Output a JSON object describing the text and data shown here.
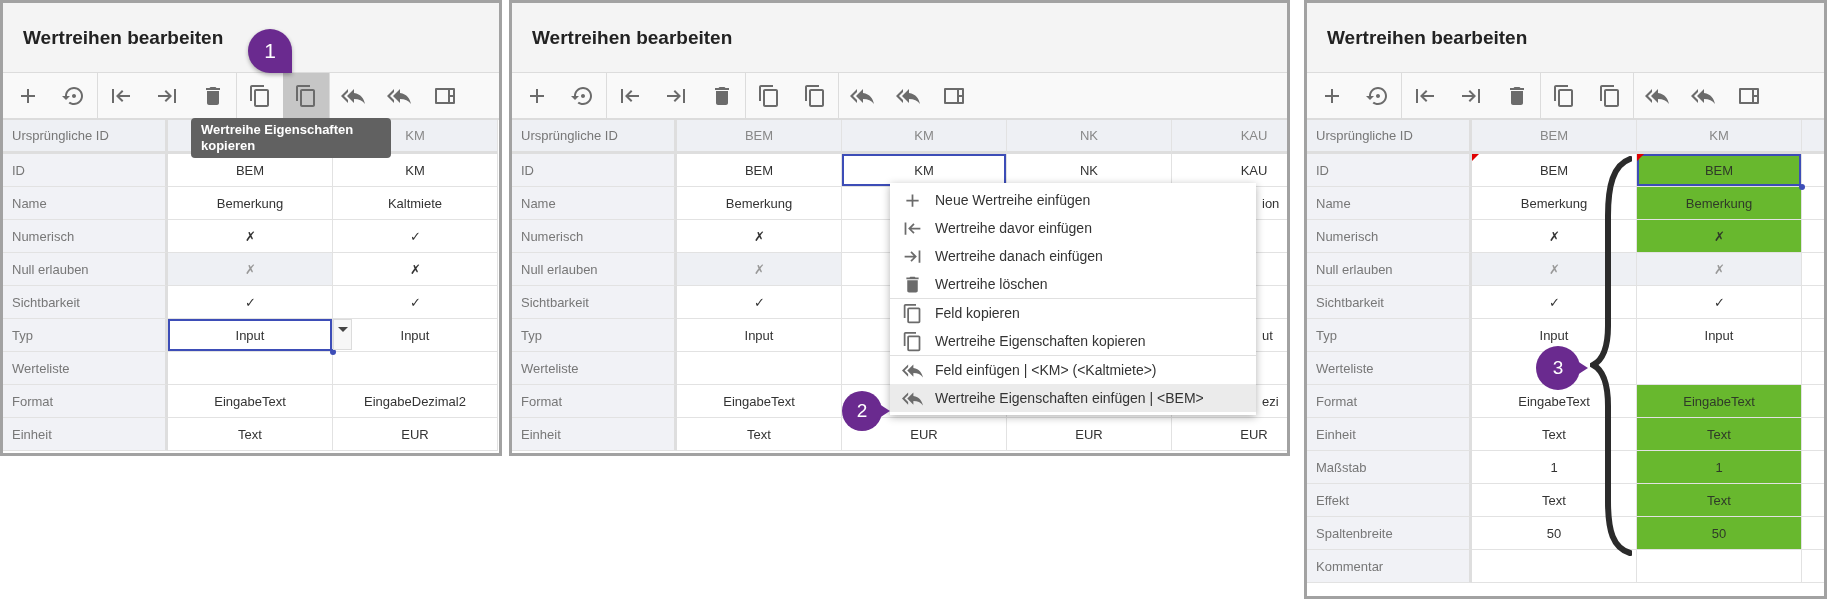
{
  "panels": [
    {
      "title": "Wertreihen bearbeiten",
      "toolbar": [
        [
          {
            "kind": "add",
            "selected": false
          },
          {
            "kind": "restore",
            "selected": false
          }
        ],
        [
          {
            "kind": "before",
            "selected": false
          },
          {
            "kind": "after",
            "selected": false
          },
          {
            "kind": "delete",
            "selected": false
          }
        ],
        [
          {
            "kind": "copy",
            "selected": false
          },
          {
            "kind": "copy",
            "selected": true
          }
        ],
        [
          {
            "kind": "paste",
            "selected": false
          },
          {
            "kind": "paste",
            "selected": false
          },
          {
            "kind": "panel",
            "selected": false
          }
        ]
      ],
      "grid": {
        "corner": "Ursprüngliche ID",
        "columns": [
          {},
          {
            "label": "KM"
          }
        ],
        "rows": [
          {
            "label": "ID",
            "cells": [
              {
                "text": "BEM",
                "selected": false,
                "readonly": false
              },
              {
                "text": "KM",
                "selected": false,
                "readonly": false
              }
            ]
          },
          {
            "label": "Name",
            "cells": [
              {
                "text": "Bemerkung",
                "selected": false,
                "readonly": false
              },
              {
                "text": "Kaltmiete",
                "selected": false,
                "readonly": false
              }
            ]
          },
          {
            "label": "Numerisch",
            "cells": [
              {
                "text": "✗",
                "selected": false,
                "readonly": false
              },
              {
                "text": "✓",
                "selected": false,
                "readonly": false
              }
            ]
          },
          {
            "label": "Null erlauben",
            "cells": [
              {
                "text": "✗",
                "selected": false,
                "readonly": true
              },
              {
                "text": "✗",
                "selected": false,
                "readonly": false
              }
            ]
          },
          {
            "label": "Sichtbarkeit",
            "cells": [
              {
                "text": "✓",
                "selected": false,
                "readonly": false
              },
              {
                "text": "✓",
                "selected": false,
                "readonly": false
              }
            ]
          },
          {
            "label": "Typ",
            "cells": [
              {
                "text": "Input",
                "selected": true,
                "readonly": false,
                "dropdown": true,
                "fill_handle": true
              },
              {
                "text": "Input",
                "selected": false,
                "readonly": false
              }
            ]
          },
          {
            "label": "Werteliste",
            "cells": [
              {
                "selected": false,
                "readonly": false
              },
              {
                "selected": false,
                "readonly": false
              }
            ]
          },
          {
            "label": "Format",
            "cells": [
              {
                "text": "EingabeText",
                "selected": false,
                "readonly": false
              },
              {
                "text": "EingabeDezimal2",
                "selected": false,
                "readonly": false
              }
            ]
          },
          {
            "label": "Einheit",
            "cells": [
              {
                "text": "Text",
                "selected": false,
                "readonly": false
              },
              {
                "text": "EUR",
                "selected": false,
                "readonly": false
              }
            ]
          }
        ]
      },
      "tooltip": "Wertreihe Eigenschaften kopieren",
      "callout": "1"
    },
    {
      "title": "Wertreihen bearbeiten",
      "toolbar": [
        [
          {
            "kind": "add",
            "selected": false
          },
          {
            "kind": "restore",
            "selected": false
          }
        ],
        [
          {
            "kind": "before",
            "selected": false
          },
          {
            "kind": "after",
            "selected": false
          },
          {
            "kind": "delete",
            "selected": false
          }
        ],
        [
          {
            "kind": "copy",
            "selected": false
          },
          {
            "kind": "copy",
            "selected": false
          }
        ],
        [
          {
            "kind": "paste",
            "selected": false
          },
          {
            "kind": "paste",
            "selected": false
          },
          {
            "kind": "panel",
            "selected": false
          }
        ]
      ],
      "grid": {
        "corner": "Ursprüngliche ID",
        "columns": [
          {
            "label": "BEM"
          },
          {
            "label": "KM"
          },
          {
            "label": "NK"
          },
          {
            "label": "KAU"
          }
        ],
        "rows": [
          {
            "label": "ID",
            "cells": [
              {
                "text": "BEM",
                "selected": false,
                "readonly": false
              },
              {
                "text": "KM",
                "selected": true,
                "readonly": false
              },
              {
                "text": "NK",
                "selected": false,
                "readonly": false
              },
              {
                "text": "KAU",
                "selected": false,
                "readonly": false
              }
            ]
          },
          {
            "label": "Name",
            "cells": [
              {
                "text": "Bemerkung",
                "selected": false,
                "readonly": false
              },
              {},
              {},
              {
                "text": "ion",
                "clipped": true,
                "selected": false,
                "readonly": false
              }
            ]
          },
          {
            "label": "Numerisch",
            "cells": [
              {
                "text": "✗",
                "selected": false,
                "readonly": false
              },
              {},
              {},
              {
                "selected": false,
                "readonly": false
              }
            ]
          },
          {
            "label": "Null erlauben",
            "cells": [
              {
                "text": "✗",
                "selected": false,
                "readonly": true
              },
              {},
              {},
              {
                "selected": false,
                "readonly": false
              }
            ]
          },
          {
            "label": "Sichtbarkeit",
            "cells": [
              {
                "text": "✓",
                "selected": false,
                "readonly": false
              },
              {},
              {},
              {
                "selected": false,
                "readonly": false
              }
            ]
          },
          {
            "label": "Typ",
            "cells": [
              {
                "text": "Input",
                "selected": false,
                "readonly": false
              },
              {},
              {},
              {
                "text": "ut",
                "clipped": true,
                "selected": false,
                "readonly": false
              }
            ]
          },
          {
            "label": "Werteliste",
            "cells": [
              {
                "selected": false,
                "readonly": false
              },
              {},
              {},
              {
                "selected": false,
                "readonly": false
              }
            ]
          },
          {
            "label": "Format",
            "cells": [
              {
                "text": "EingabeText",
                "selected": false,
                "readonly": false
              },
              {},
              {},
              {
                "text": "ezi",
                "clipped": true,
                "selected": false,
                "readonly": false
              }
            ]
          },
          {
            "label": "Einheit",
            "cells": [
              {
                "text": "Text",
                "selected": false,
                "readonly": false
              },
              {
                "text": "EUR",
                "selected": false,
                "readonly": false
              },
              {
                "text": "EUR",
                "selected": false,
                "readonly": false
              },
              {
                "text": "EUR",
                "selected": false,
                "readonly": false
              }
            ]
          }
        ]
      },
      "context_menu": [
        [
          {
            "kind": "add",
            "text": "Neue Wertreihe einfügen",
            "selected": false
          },
          {
            "kind": "before",
            "text": "Wertreihe davor einfügen",
            "selected": false
          },
          {
            "kind": "after",
            "text": "Wertreihe danach einfügen",
            "selected": false
          },
          {
            "kind": "delete",
            "text": "Wertreihe löschen",
            "selected": false
          }
        ],
        [
          {
            "kind": "copy",
            "text": "Feld kopieren",
            "selected": false
          },
          {
            "kind": "copy",
            "text": "Wertreihe Eigenschaften kopieren",
            "selected": false
          }
        ],
        [
          {
            "kind": "paste",
            "text": "Feld einfügen | <KM> (<Kaltmiete>)",
            "selected": false
          },
          {
            "kind": "paste",
            "text": "Wertreihe Eigenschaften einfügen | <BEM>",
            "selected": true
          }
        ]
      ],
      "callout": "2"
    },
    {
      "title": "Wertreihen bearbeiten",
      "toolbar": [
        [
          {
            "kind": "add",
            "selected": false
          },
          {
            "kind": "restore",
            "selected": false
          }
        ],
        [
          {
            "kind": "before",
            "selected": false
          },
          {
            "kind": "after",
            "selected": false
          },
          {
            "kind": "delete",
            "selected": false
          }
        ],
        [
          {
            "kind": "copy",
            "selected": false
          },
          {
            "kind": "copy",
            "selected": false
          }
        ],
        [
          {
            "kind": "paste",
            "selected": false
          },
          {
            "kind": "paste",
            "selected": false
          },
          {
            "kind": "panel",
            "selected": false
          }
        ]
      ],
      "grid": {
        "corner": "Ursprüngliche ID",
        "columns": [
          {
            "label": "BEM"
          },
          {
            "label": "KM"
          }
        ],
        "rows": [
          {
            "label": "ID",
            "cells": [
              {
                "text": "BEM",
                "selected": false,
                "readonly": false,
                "highlighted": false,
                "marked": true
              },
              {
                "text": "BEM",
                "selected": true,
                "readonly": false,
                "highlighted": true,
                "marked": true,
                "fill_handle": true
              }
            ]
          },
          {
            "label": "Name",
            "cells": [
              {
                "text": "Bemerkung",
                "selected": false,
                "readonly": false,
                "highlighted": false,
                "marked": false
              },
              {
                "text": "Bemerkung",
                "selected": false,
                "readonly": false,
                "highlighted": true,
                "marked": false
              }
            ]
          },
          {
            "label": "Numerisch",
            "cells": [
              {
                "text": "✗",
                "selected": false,
                "readonly": false,
                "highlighted": false,
                "marked": false
              },
              {
                "text": "✗",
                "selected": false,
                "readonly": false,
                "highlighted": true,
                "marked": false
              }
            ]
          },
          {
            "label": "Null erlauben",
            "cells": [
              {
                "text": "✗",
                "selected": false,
                "readonly": true,
                "highlighted": false,
                "marked": false
              },
              {
                "text": "✗",
                "selected": false,
                "readonly": true,
                "highlighted": false,
                "marked": false
              }
            ]
          },
          {
            "label": "Sichtbarkeit",
            "cells": [
              {
                "text": "✓",
                "selected": false,
                "readonly": false,
                "highlighted": false,
                "marked": false
              },
              {
                "text": "✓",
                "selected": false,
                "readonly": false,
                "highlighted": false,
                "marked": false
              }
            ]
          },
          {
            "label": "Typ",
            "cells": [
              {
                "text": "Input",
                "selected": false,
                "readonly": false,
                "highlighted": false,
                "marked": false
              },
              {
                "text": "Input",
                "selected": false,
                "readonly": false,
                "highlighted": false,
                "marked": false
              }
            ]
          },
          {
            "label": "Werteliste",
            "cells": [
              {
                "selected": false,
                "readonly": false,
                "highlighted": false,
                "marked": false
              },
              {
                "selected": false,
                "readonly": false,
                "highlighted": false,
                "marked": false
              }
            ]
          },
          {
            "label": "Format",
            "cells": [
              {
                "text": "EingabeText",
                "selected": false,
                "readonly": false,
                "highlighted": false,
                "marked": false
              },
              {
                "text": "EingabeText",
                "selected": false,
                "readonly": false,
                "highlighted": true,
                "marked": false
              }
            ]
          },
          {
            "label": "Einheit",
            "cells": [
              {
                "text": "Text",
                "selected": false,
                "readonly": false,
                "highlighted": false,
                "marked": false
              },
              {
                "text": "Text",
                "selected": false,
                "readonly": false,
                "highlighted": true,
                "marked": false
              }
            ]
          },
          {
            "label": "Maßstab",
            "cells": [
              {
                "text": "1",
                "selected": false,
                "readonly": false,
                "highlighted": false,
                "marked": false
              },
              {
                "text": "1",
                "selected": false,
                "readonly": false,
                "highlighted": true,
                "marked": false
              }
            ]
          },
          {
            "label": "Effekt",
            "cells": [
              {
                "text": "Text",
                "selected": false,
                "readonly": false,
                "highlighted": false,
                "marked": false
              },
              {
                "text": "Text",
                "selected": false,
                "readonly": false,
                "highlighted": true,
                "marked": false
              }
            ]
          },
          {
            "label": "Spaltenbreite",
            "cells": [
              {
                "text": "50",
                "selected": false,
                "readonly": false,
                "highlighted": false,
                "marked": false
              },
              {
                "text": "50",
                "selected": false,
                "readonly": false,
                "highlighted": true,
                "marked": false
              }
            ]
          },
          {
            "label": "Kommentar",
            "cells": [
              {
                "selected": false,
                "readonly": false,
                "highlighted": false,
                "marked": false
              },
              {
                "selected": false,
                "readonly": false,
                "highlighted": false,
                "marked": false
              }
            ]
          }
        ]
      },
      "bracket": true,
      "callout": "3"
    }
  ]
}
